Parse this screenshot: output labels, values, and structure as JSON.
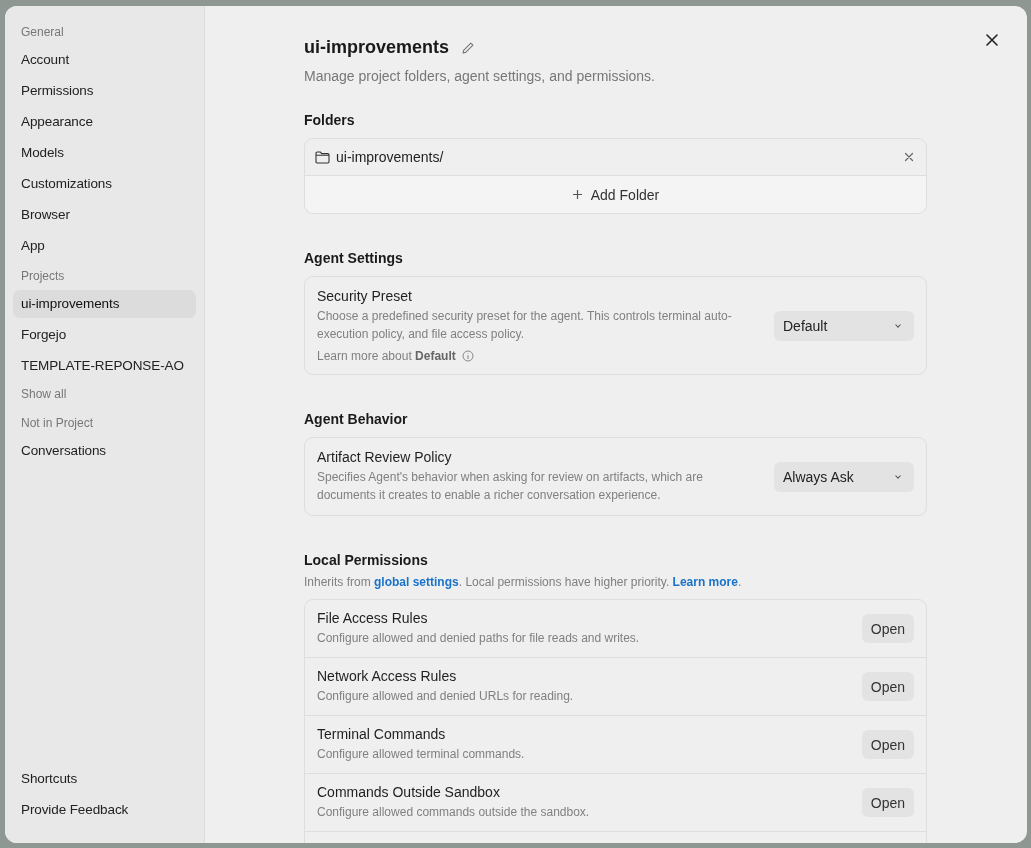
{
  "sidebar": {
    "groups": [
      {
        "heading": "General",
        "items": [
          {
            "label": "Account",
            "selected": false
          },
          {
            "label": "Permissions",
            "selected": false
          },
          {
            "label": "Appearance",
            "selected": false
          },
          {
            "label": "Models",
            "selected": false
          },
          {
            "label": "Customizations",
            "selected": false
          },
          {
            "label": "Browser",
            "selected": false
          },
          {
            "label": "App",
            "selected": false
          }
        ]
      },
      {
        "heading": "Projects",
        "items": [
          {
            "label": "ui-improvements",
            "selected": true
          },
          {
            "label": "Forgejo",
            "selected": false
          },
          {
            "label": "TEMPLATE-REPONSE-AO",
            "selected": false
          }
        ],
        "more": "Show all"
      },
      {
        "heading": "Not in Project",
        "items": [
          {
            "label": "Conversations",
            "selected": false
          }
        ]
      }
    ],
    "footer_items": [
      "Shortcuts",
      "Provide Feedback"
    ]
  },
  "header": {
    "title": "ui-improvements",
    "subtitle": "Manage project folders, agent settings, and permissions."
  },
  "folders": {
    "heading": "Folders",
    "items": [
      "ui-improvements/"
    ],
    "add_label": "Add Folder"
  },
  "agent_settings": {
    "heading": "Agent Settings",
    "settings": [
      {
        "title": "Security Preset",
        "description": "Choose a predefined security preset for the agent. This controls terminal auto-execution policy, and file access policy.",
        "dropdown": "Default",
        "note": "Learn more about **Default**"
      }
    ]
  },
  "agent_behavior": {
    "heading": "Agent Behavior",
    "settings": [
      {
        "title": "Artifact Review Policy",
        "description": "Specifies Agent's behavior when asking for review on artifacts, which are documents it creates to enable a richer conversation experience.",
        "dropdown": "Always Ask"
      }
    ]
  },
  "local_permissions": {
    "heading": "Local Permissions",
    "intro": [
      {
        "kind": "text",
        "text": "Inherits from "
      },
      {
        "kind": "link",
        "text": "global settings"
      },
      {
        "kind": "text",
        "text": ". Local permissions have higher priority. "
      },
      {
        "kind": "link",
        "text": "Learn more"
      },
      {
        "kind": "text",
        "text": "."
      }
    ],
    "rules": [
      {
        "title": "File Access Rules",
        "description": "Configure allowed and denied paths for file reads and writes.",
        "button": "Open"
      },
      {
        "title": "Network Access Rules",
        "description": "Configure allowed and denied URLs for reading.",
        "button": "Open"
      },
      {
        "title": "Terminal Commands",
        "description": "Configure allowed terminal commands.",
        "button": "Open"
      },
      {
        "title": "Commands Outside Sandbox",
        "description": "Configure allowed commands outside the sandbox.",
        "button": "Open"
      }
    ]
  }
}
